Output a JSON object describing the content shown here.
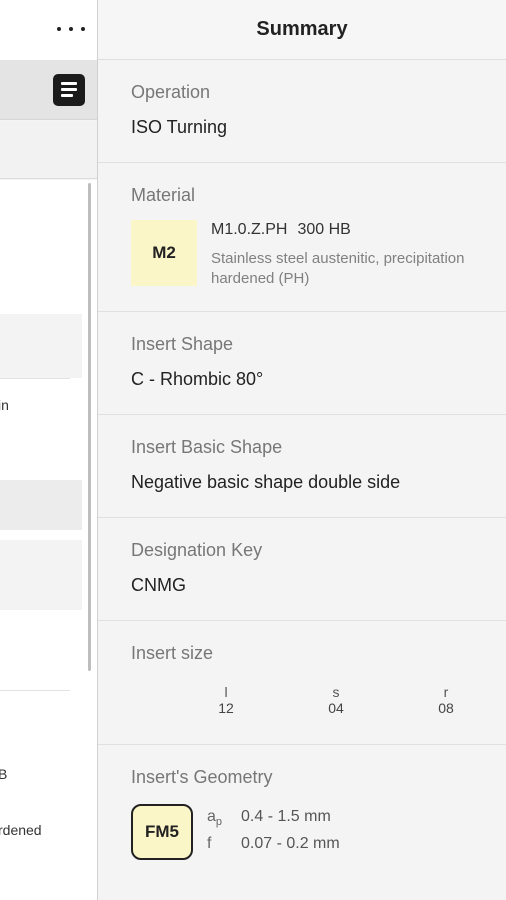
{
  "left_panel": {
    "ghost_texts": [
      "in",
      "B",
      "rdened"
    ]
  },
  "summary": {
    "title": "Summary",
    "operation": {
      "label": "Operation",
      "value": "ISO Turning"
    },
    "material": {
      "label": "Material",
      "badge": "M2",
      "code": "M1.0.Z.PH",
      "hardness": "300 HB",
      "description": "Stainless steel austenitic, precipitation hardened (PH)"
    },
    "insert_shape": {
      "label": "Insert Shape",
      "value": "C - Rhombic 80°"
    },
    "insert_basic_shape": {
      "label": "Insert Basic Shape",
      "value": "Negative basic shape double side"
    },
    "designation_key": {
      "label": "Designation Key",
      "value": "CNMG"
    },
    "insert_size": {
      "label": "Insert size",
      "columns": [
        {
          "symbol": "l",
          "value": "12"
        },
        {
          "symbol": "s",
          "value": "04"
        },
        {
          "symbol": "r",
          "value": "08"
        }
      ]
    },
    "insert_geometry": {
      "label": "Insert's Geometry",
      "badge": "FM5",
      "params": [
        {
          "symbol": "a",
          "subscript": "p",
          "range": "0.4  -  1.5 mm"
        },
        {
          "symbol": "f",
          "subscript": "",
          "range": "0.07  -  0.2 mm"
        }
      ]
    }
  },
  "colors": {
    "material_badge": "#fbf6c7",
    "panel_bg": "#f4f4f4"
  }
}
